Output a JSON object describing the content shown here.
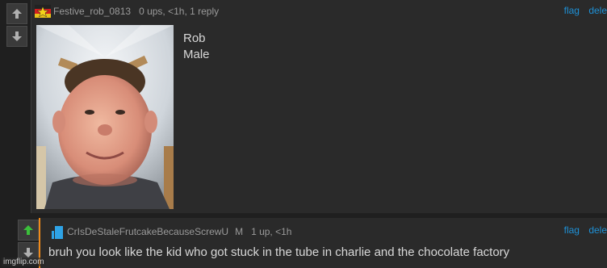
{
  "comment1": {
    "username": "Festive_rob_0813",
    "meta": "0 ups, <1h, 1 reply",
    "actions": [
      "flag",
      "dele"
    ],
    "caption_lines": [
      "Rob",
      "Male"
    ],
    "vote_up_icon": "arrow-up-icon",
    "vote_down_icon": "arrow-down-icon"
  },
  "comment2": {
    "username": "CrIsDeStaleFrutcakeBecauseScrewU",
    "badge": "M",
    "meta": "1 up, <1h",
    "actions": [
      "flag",
      "dele"
    ],
    "text": "bruh you look like the kid who got stuck in the tube in charlie and the chocolate factory",
    "upvote_color": "#3bbf3b"
  },
  "watermark": "imgflip.com",
  "colors": {
    "background": "#1f1f1f",
    "panel": "#2a2a2a",
    "link": "#1e90d6",
    "accent": "#f08a1a"
  }
}
